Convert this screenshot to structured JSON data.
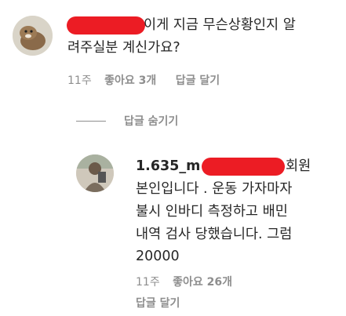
{
  "comment": {
    "line1_suffix": "이게 지금 무슨상황인지 알",
    "line2": "려주실분 계신가요?",
    "time": "11주",
    "likes": "좋아요 3개",
    "reply": "답글 달기"
  },
  "hide_replies": "답글 숨기기",
  "reply_comment": {
    "username": "1.635_m",
    "line1_suffix": "회원",
    "line2": "본인입니다 . 운동 가자마자",
    "line3": "불시 인바디 측정하고 배민",
    "line4": "내역 검사 당했습니다. 그럼",
    "line5": "20000",
    "time": "11주",
    "likes": "좋아요 26개",
    "reply": "답글 달기"
  },
  "colors": {
    "text": "#262626",
    "secondary": "#8e8e8e",
    "redaction": "#ec1c24"
  }
}
